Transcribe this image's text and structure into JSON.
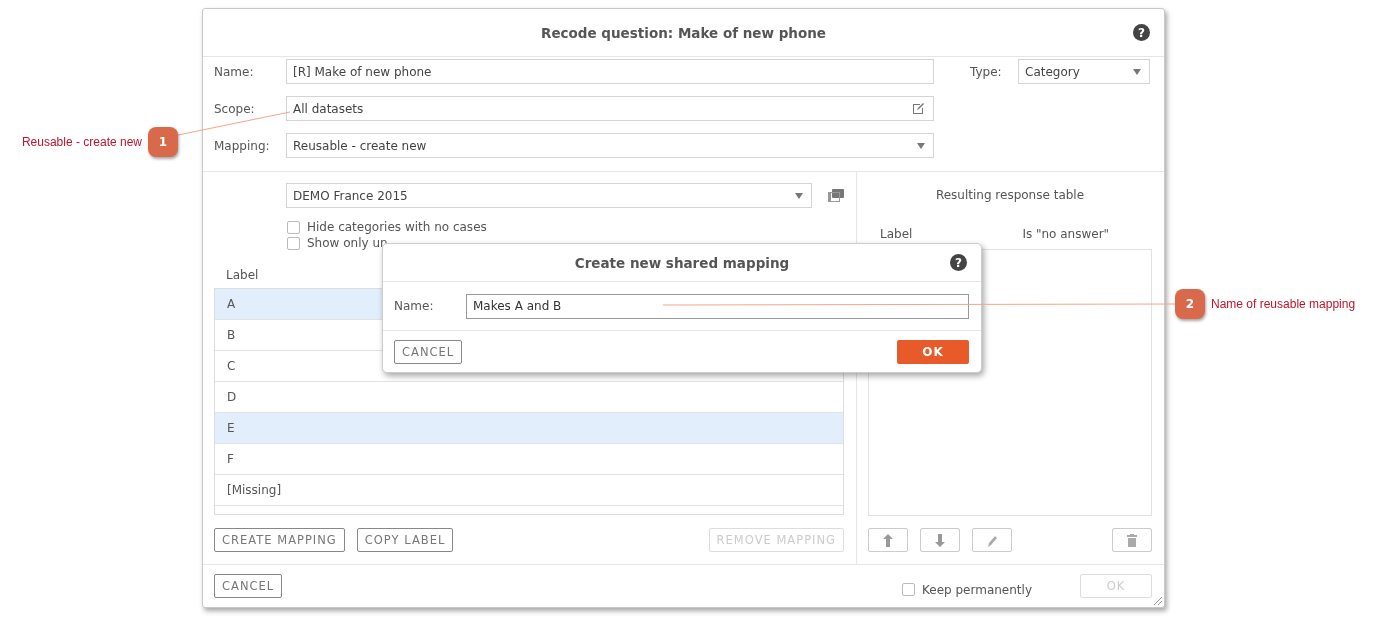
{
  "dialog": {
    "title": "Recode question: Make of new phone",
    "help": "?",
    "fields": [
      {
        "label": "Name:",
        "value": "[R] Make of new phone",
        "kind": "text"
      },
      {
        "label": "Scope:",
        "value": "All datasets",
        "kind": "edit"
      },
      {
        "label": "Mapping:",
        "value": "Reusable - create new",
        "kind": "select"
      }
    ],
    "type": {
      "label": "Type:",
      "value": "Category"
    },
    "dataset": "DEMO France 2015",
    "options": [
      {
        "label": "Hide categories with no cases",
        "checked": false
      },
      {
        "label": "Show only un",
        "checked": false
      }
    ],
    "table": {
      "columns": [
        "Label"
      ],
      "rows": [
        {
          "label": "A",
          "selected": true
        },
        {
          "label": "B",
          "selected": false
        },
        {
          "label": "C",
          "selected": false
        },
        {
          "label": "D",
          "selected": false
        },
        {
          "label": "E",
          "selected": true
        },
        {
          "label": "F",
          "selected": false
        },
        {
          "label": "[Missing]",
          "selected": false
        }
      ]
    },
    "mapping_buttons": [
      {
        "label": "CREATE MAPPING",
        "disabled": false
      },
      {
        "label": "COPY LABEL",
        "disabled": false
      },
      {
        "label": "REMOVE MAPPING",
        "disabled": true
      }
    ],
    "result": {
      "title": "Resulting response table",
      "columns": [
        "Label",
        "Is \"no answer\""
      ],
      "tools": [
        {
          "kind": "up"
        },
        {
          "kind": "down"
        },
        {
          "kind": "edit"
        },
        {
          "kind": "delete"
        }
      ]
    },
    "footer": {
      "cancel": "CANCEL",
      "keep": {
        "label": "Keep permanently",
        "checked": false
      },
      "ok": {
        "label": "OK",
        "disabled": true
      }
    }
  },
  "modal": {
    "title": "Create new shared mapping",
    "help": "?",
    "label": "Name:",
    "value": "Makes A and B",
    "cancel": "CANCEL",
    "ok": "OK"
  },
  "callouts": [
    {
      "number": "1",
      "text": "Reusable - create new"
    },
    {
      "number": "2",
      "text": "Name of reusable mapping"
    }
  ]
}
